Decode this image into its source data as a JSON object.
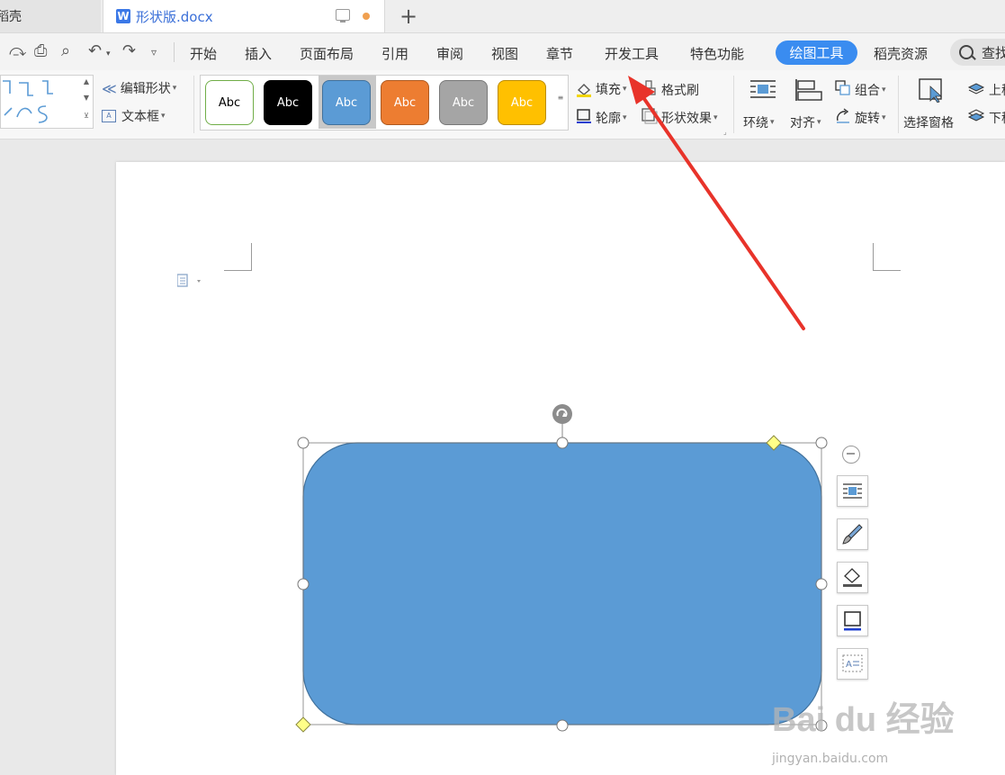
{
  "tabs": {
    "prev_label": "稻壳",
    "active_label": "形状版.docx",
    "word_glyph": "W",
    "add_glyph": "+"
  },
  "menu": {
    "items": [
      "开始",
      "插入",
      "页面布局",
      "引用",
      "审阅",
      "视图",
      "章节",
      "开发工具",
      "特色功能"
    ],
    "drawing_tools": "绘图工具",
    "docer_resources": "稻壳资源",
    "search_label": "查找"
  },
  "ribbon": {
    "edit_shape": "编辑形状",
    "text_box": "文本框",
    "style_chips": [
      {
        "label": "Abc",
        "fill": "#ffffff",
        "border": "#70ad47",
        "text": "#000000"
      },
      {
        "label": "Abc",
        "fill": "#000000",
        "border": "#000000",
        "text": "#ffffff"
      },
      {
        "label": "Abc",
        "fill": "#5b9bd5",
        "border": "#41719c",
        "text": "#ffffff"
      },
      {
        "label": "Abc",
        "fill": "#ed7d31",
        "border": "#ae5a21",
        "text": "#ffffff"
      },
      {
        "label": "Abc",
        "fill": "#a5a5a5",
        "border": "#787878",
        "text": "#ffffff"
      },
      {
        "label": "Abc",
        "fill": "#ffc000",
        "border": "#bc8c00",
        "text": "#ffffff"
      }
    ],
    "fill": "填充",
    "format_painter": "格式刷",
    "outline": "轮廓",
    "shape_effects": "形状效果",
    "wrap": "环绕",
    "align": "对齐",
    "group": "组合",
    "rotate": "旋转",
    "selection_pane": "选择窗格",
    "bring_forward": "上移",
    "send_backward": "下移"
  },
  "shape": {
    "fill_color": "#5b9bd5",
    "outline_color": "#41719c"
  },
  "watermark": {
    "brand": "Bai du 经验",
    "url": "jingyan.baidu.com"
  },
  "colors": {
    "accent": "#3a8cf0",
    "arrow": "#e8332a"
  }
}
